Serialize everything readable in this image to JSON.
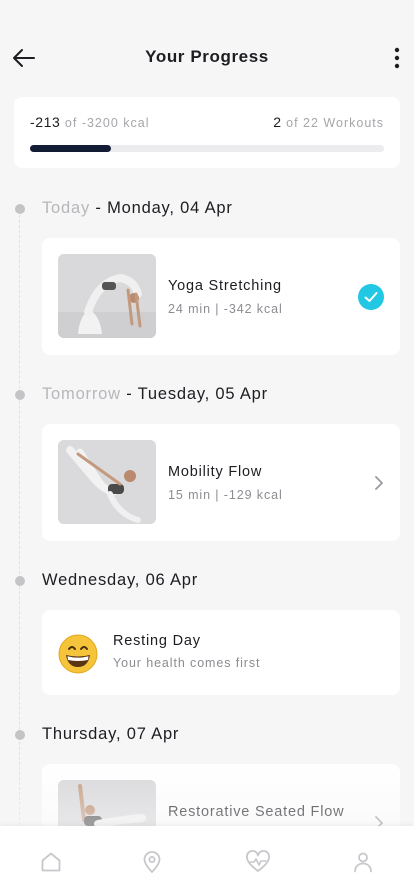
{
  "header": {
    "title": "Your Progress",
    "back_icon": "arrow-left-icon",
    "menu_icon": "more-vertical-icon"
  },
  "summary": {
    "kcal_value": "-213",
    "kcal_suffix": "of -3200 kcal",
    "workouts_value": "2",
    "workouts_suffix": "of 22 Workouts",
    "progress_fraction": 0.23,
    "progress_color": "#131c35"
  },
  "days": [
    {
      "relative": "Today",
      "date": "- Monday, 04 Apr"
    },
    {
      "relative": "Tomorrow",
      "date": "- Tuesday, 05 Apr"
    },
    {
      "relative": "",
      "date": "Wednesday, 06 Apr"
    },
    {
      "relative": "",
      "date": "Thursday, 07 Apr"
    }
  ],
  "workouts": [
    {
      "title": "Yoga Stretching",
      "meta": "24 min | -342 kcal",
      "status": "completed",
      "status_color": "#22c7e3"
    },
    {
      "title": "Mobility Flow",
      "meta": "15 min | -129 kcal",
      "status": "upcoming"
    },
    {
      "title": "Restorative Seated Flow",
      "meta": "",
      "status": "upcoming"
    }
  ],
  "rest_day": {
    "title": "Resting Day",
    "subtitle": "Your health comes first",
    "icon": "grinning-face-emoji"
  },
  "tabbar": {
    "icons": [
      "home-icon",
      "location-pin-icon",
      "heart-pulse-icon",
      "profile-icon"
    ]
  }
}
